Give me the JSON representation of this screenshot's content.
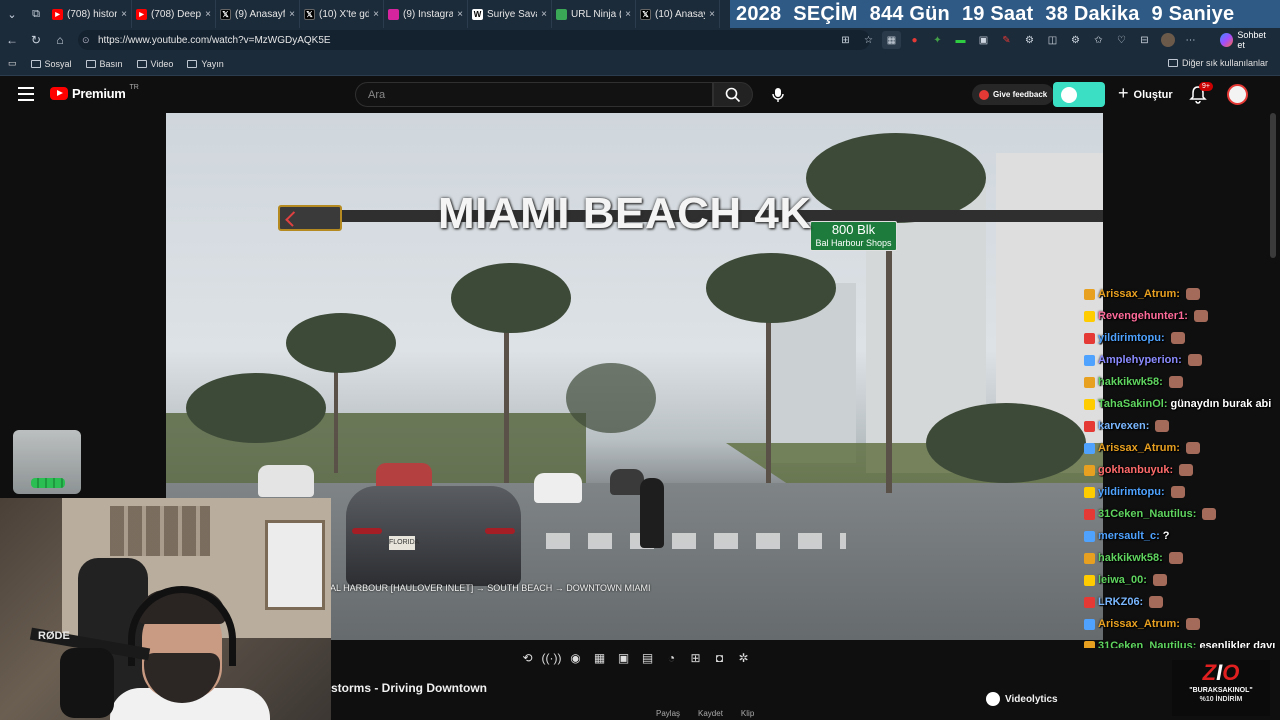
{
  "browser": {
    "tabs": [
      {
        "title": "(708) history",
        "icon": "youtube-icon",
        "color": "#ff0000"
      },
      {
        "title": "(708) Deep F",
        "icon": "youtube-icon",
        "color": "#ff0000"
      },
      {
        "title": "(9) Anasayfa",
        "icon": "x-icon",
        "color": "#000000"
      },
      {
        "title": "(10) X'te gd",
        "icon": "x-icon",
        "color": "#000000"
      },
      {
        "title": "(9) Instagram",
        "icon": "instagram-icon",
        "color": "#d6249f"
      },
      {
        "title": "Suriye Savaş",
        "icon": "wikipedia-icon",
        "color": "#ffffff"
      },
      {
        "title": "URL Ninja (6)",
        "icon": "link-icon",
        "color": "#3aa757"
      },
      {
        "title": "(10) Anasayfa",
        "icon": "x-icon",
        "color": "#000000"
      }
    ],
    "countdown": {
      "year": "2028",
      "event": "SEÇİM",
      "days": "844 Gün",
      "hours": "19 Saat",
      "minutes": "38 Dakika",
      "seconds": "9 Saniye"
    },
    "url": "https://www.youtube.com/watch?v=MzWGDyAQK5E",
    "chat_button": "Sohbet et",
    "bookmarks": [
      "Sosyal",
      "Basın",
      "Video",
      "Yayın"
    ],
    "other_bookmarks": "Diğer sık kullanılanlar"
  },
  "youtube": {
    "logo_text": "Premium",
    "country_code": "TR",
    "search_placeholder": "Ara",
    "feedback_label": "Give feedback",
    "create_label": "Oluştur",
    "notification_count": "9+"
  },
  "video": {
    "overlay_title": "MIAMI BEACH 4K",
    "street_sign_line1": "800 Blk",
    "street_sign_line2": "Bal Harbour Shops",
    "plate": "FLORIDA",
    "route_subtitle": "AL HARBOUR [HAULOVER INLET] → SOUTH BEACH → DOWNTOWN MIAMI",
    "title": "storms - Driving Downtown"
  },
  "chat": {
    "messages": [
      {
        "user": "Arissax_Atrum:",
        "text": "",
        "color": "#e8a020"
      },
      {
        "user": "Revengehunter1:",
        "text": "",
        "color": "#ff6b9a"
      },
      {
        "user": "yildirimtopu:",
        "text": "",
        "color": "#4fa3ff"
      },
      {
        "user": "Amplehyperion:",
        "text": "",
        "color": "#8b8bff"
      },
      {
        "user": "hakkikwk58:",
        "text": "",
        "color": "#5fd45f"
      },
      {
        "user": "TahaSakinOl:",
        "text": "günaydın burak abi",
        "color": "#5fd45f"
      },
      {
        "user": "karvexen:",
        "text": "",
        "color": "#7ab7ff"
      },
      {
        "user": "Arissax_Atrum:",
        "text": "",
        "color": "#e8a020"
      },
      {
        "user": "gokhanbuyuk:",
        "text": "",
        "color": "#ff6b6b"
      },
      {
        "user": "yildirimtopu:",
        "text": "",
        "color": "#4fa3ff"
      },
      {
        "user": "31Ceken_Nautilus:",
        "text": "",
        "color": "#5fd45f"
      },
      {
        "user": "mersault_c:",
        "text": "?",
        "color": "#4fa3ff"
      },
      {
        "user": "hakkikwk58:",
        "text": "",
        "color": "#5fd45f"
      },
      {
        "user": "leiwa_00:",
        "text": "",
        "color": "#5fd45f"
      },
      {
        "user": "LRKZ06:",
        "text": "",
        "color": "#7ab7ff"
      },
      {
        "user": "Arissax_Atrum:",
        "text": "",
        "color": "#e8a020"
      },
      {
        "user": "31Ceken_Nautilus:",
        "text": "esenlikler dayı",
        "color": "#5fd45f"
      }
    ]
  },
  "webcam": {
    "mic_brand": "RØDE"
  },
  "overlay": {
    "sponsor_line1": "\"BURAKSAKINOL\"",
    "sponsor_line2": "%10 İNDİRİM"
  },
  "page": {
    "videolytics_label": "Videolytics",
    "actions": [
      "Paylaş",
      "Kaydet",
      "Klip"
    ]
  }
}
